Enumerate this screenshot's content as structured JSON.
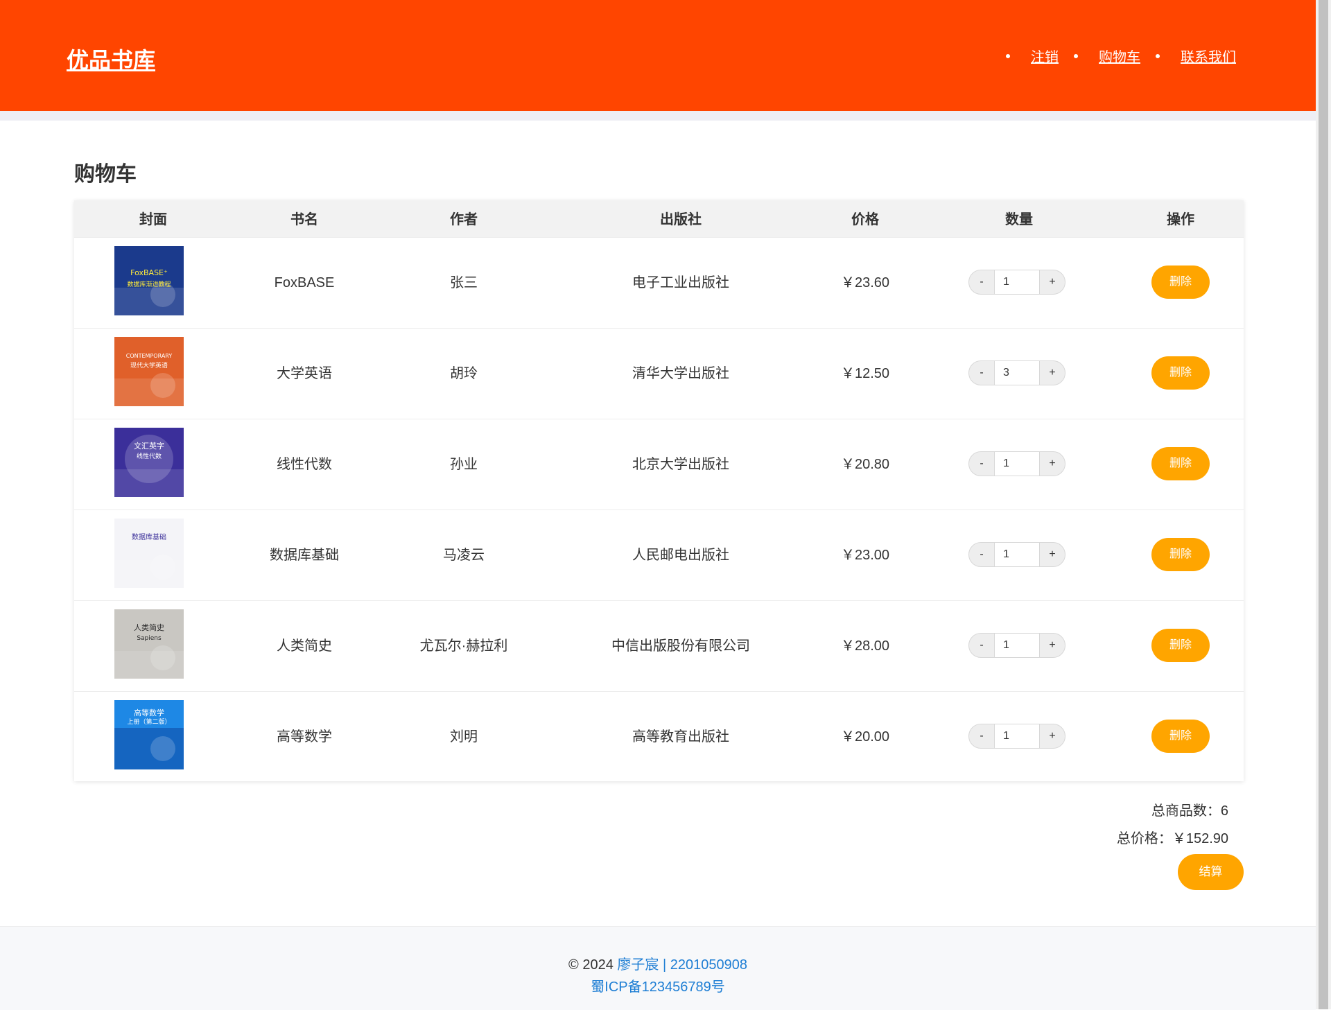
{
  "header": {
    "logo": "优品书库",
    "nav": [
      "注销",
      "购物车",
      "联系我们"
    ]
  },
  "page_title": "购物车",
  "table": {
    "columns": [
      "封面",
      "书名",
      "作者",
      "出版社",
      "价格",
      "数量",
      "操作"
    ],
    "rows": [
      {
        "title": "FoxBASE",
        "author": "张三",
        "publisher": "电子工业出版社",
        "price": "￥23.60",
        "qty": "1",
        "action": "删除"
      },
      {
        "title": "大学英语",
        "author": "胡玲",
        "publisher": "清华大学出版社",
        "price": "￥12.50",
        "qty": "3",
        "action": "删除"
      },
      {
        "title": "线性代数",
        "author": "孙业",
        "publisher": "北京大学出版社",
        "price": "￥20.80",
        "qty": "1",
        "action": "删除"
      },
      {
        "title": "数据库基础",
        "author": "马凌云",
        "publisher": "人民邮电出版社",
        "price": "￥23.00",
        "qty": "1",
        "action": "删除"
      },
      {
        "title": "人类简史",
        "author": "尤瓦尔·赫拉利",
        "publisher": "中信出版股份有限公司",
        "price": "￥28.00",
        "qty": "1",
        "action": "删除"
      },
      {
        "title": "高等数学",
        "author": "刘明",
        "publisher": "高等教育出版社",
        "price": "￥20.00",
        "qty": "1",
        "action": "删除"
      }
    ],
    "minus": "-",
    "plus": "+"
  },
  "summary": {
    "total_items": "总商品数：6",
    "total_price": "总价格：￥152.90",
    "checkout": "结算"
  },
  "covers": [
    {
      "line1": "FoxBASE⁺",
      "line2": "数据库渐进教程"
    },
    {
      "line1": "CONTEMPORARY",
      "line2": "现代大学英语"
    },
    {
      "line1": "文汇英字",
      "line2": "线性代数"
    },
    {
      "line1": "数据库基础",
      "line2": ""
    },
    {
      "line1": "人类简史",
      "line2": "Sapiens"
    },
    {
      "line1": "高等数学",
      "line2": "上册（第二版）"
    }
  ],
  "footer": {
    "copy": "© 2024",
    "author": "廖子宸 | 2201050908",
    "icp": "蜀ICP备123456789号"
  },
  "colors": {
    "brand": "#ff4500",
    "accent": "#ffa500",
    "link": "#1e7ed4"
  }
}
